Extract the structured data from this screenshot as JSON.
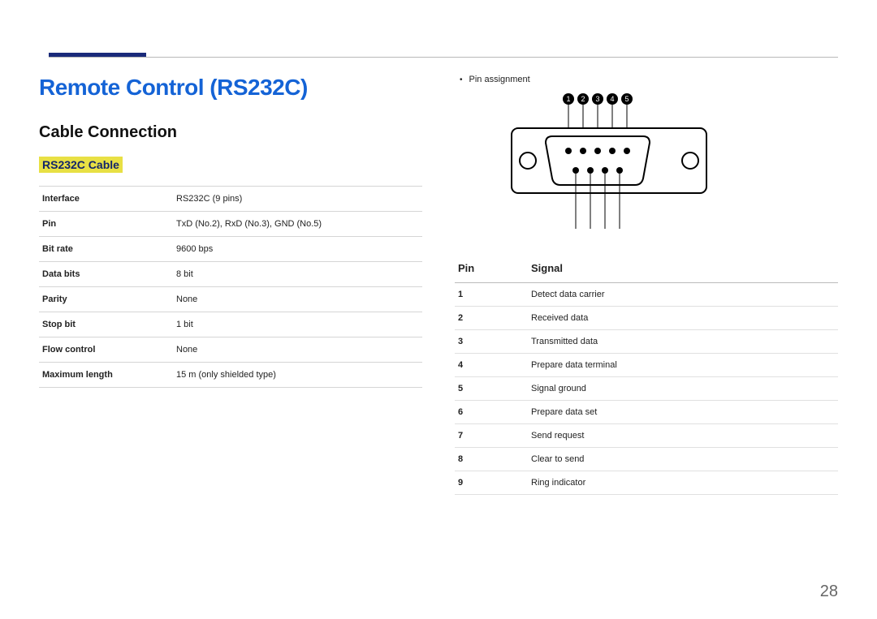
{
  "page_number": "28",
  "title": "Remote Control (RS232C)",
  "section": "Cable Connection",
  "subsection": "RS232C Cable",
  "spec_table": [
    {
      "k": "Interface",
      "v": "RS232C (9 pins)"
    },
    {
      "k": "Pin",
      "v": "TxD (No.2), RxD (No.3), GND (No.5)"
    },
    {
      "k": "Bit rate",
      "v": "9600 bps"
    },
    {
      "k": "Data bits",
      "v": "8 bit"
    },
    {
      "k": "Parity",
      "v": "None"
    },
    {
      "k": "Stop bit",
      "v": "1 bit"
    },
    {
      "k": "Flow control",
      "v": "None"
    },
    {
      "k": "Maximum length",
      "v": "15 m (only shielded type)"
    }
  ],
  "right": {
    "bullet": "Pin assignment",
    "signal_header": {
      "pin": "Pin",
      "signal": "Signal"
    },
    "signals": [
      {
        "pin": "1",
        "signal": "Detect data carrier"
      },
      {
        "pin": "2",
        "signal": "Received data"
      },
      {
        "pin": "3",
        "signal": "Transmitted data"
      },
      {
        "pin": "4",
        "signal": "Prepare data terminal"
      },
      {
        "pin": "5",
        "signal": "Signal ground"
      },
      {
        "pin": "6",
        "signal": "Prepare data set"
      },
      {
        "pin": "7",
        "signal": "Send request"
      },
      {
        "pin": "8",
        "signal": "Clear to send"
      },
      {
        "pin": "9",
        "signal": "Ring indicator"
      }
    ],
    "diagram_labels": [
      "1",
      "2",
      "3",
      "4",
      "5"
    ]
  }
}
